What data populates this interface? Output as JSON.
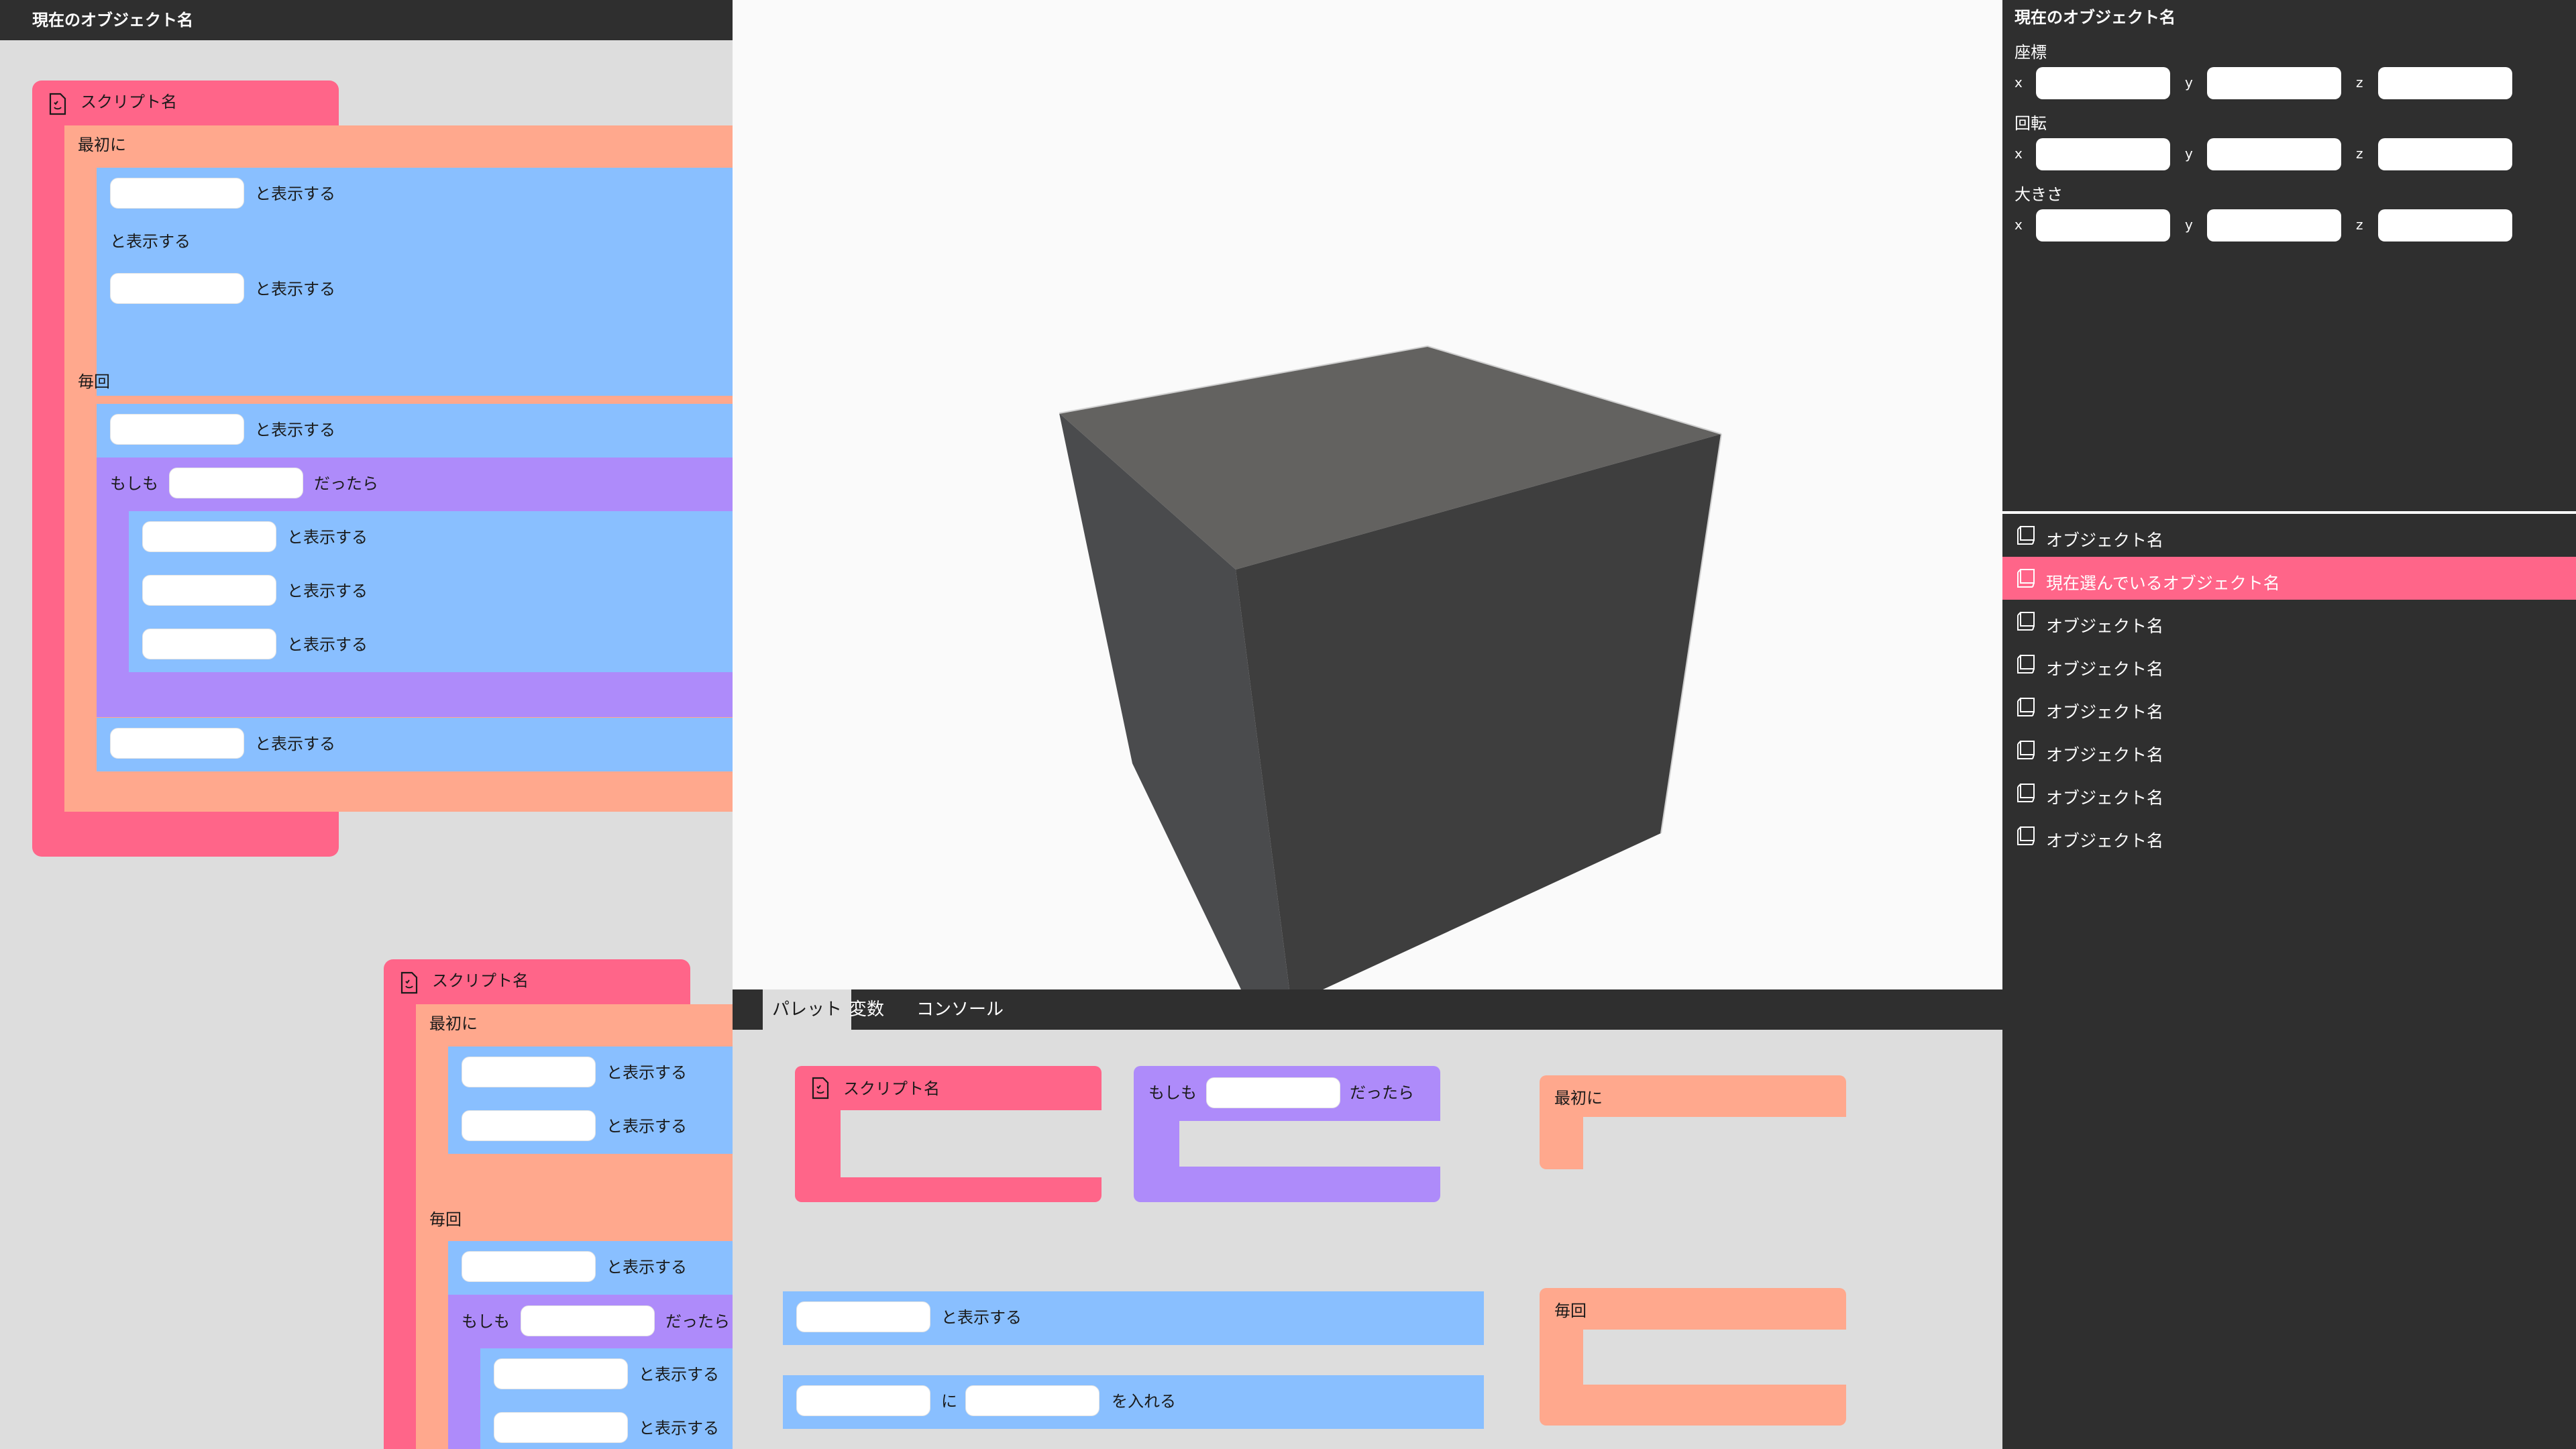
{
  "left": {
    "header_title": "現在のオブジェクト名",
    "script1": {
      "name": "スクリプト名",
      "first_label": "最初に",
      "every_label": "毎回",
      "if_label": "もしも",
      "then_label": "だったら",
      "show_label": "と表示する"
    },
    "script2": {
      "name": "スクリプト名",
      "first_label": "最初に",
      "every_label": "毎回",
      "if_label": "もしも",
      "then_label": "だったら",
      "show_label": "と表示する"
    }
  },
  "palette": {
    "tabs": [
      {
        "label": "パレット",
        "active": true
      },
      {
        "label": "変数",
        "active": false
      },
      {
        "label": "コンソール",
        "active": false
      }
    ],
    "script_block": "スクリプト名",
    "if_label": "もしも",
    "then_label": "だったら",
    "first_block": "最初に",
    "every_block": "毎回",
    "show_label": "と表示する",
    "assign_ni": "に",
    "assign_label": "を入れる"
  },
  "inspector": {
    "title": "現在のオブジェクト名",
    "position_label": "座標",
    "rotation_label": "回転",
    "scale_label": "大きさ",
    "x": "x",
    "y": "y",
    "z": "z"
  },
  "objects": [
    {
      "label": "オブジェクト名",
      "selected": false
    },
    {
      "label": "現在選んでいるオブジェクト名",
      "selected": true
    },
    {
      "label": "オブジェクト名",
      "selected": false
    },
    {
      "label": "オブジェクト名",
      "selected": false
    },
    {
      "label": "オブジェクト名",
      "selected": false
    },
    {
      "label": "オブジェクト名",
      "selected": false
    },
    {
      "label": "オブジェクト名",
      "selected": false
    },
    {
      "label": "オブジェクト名",
      "selected": false
    }
  ],
  "colors": {
    "script": "#ff6589",
    "event": "#ffa88d",
    "statement": "#89bfff",
    "control": "#ae8bfa",
    "background": "#dddddd",
    "panel": "#2f2f2f"
  }
}
